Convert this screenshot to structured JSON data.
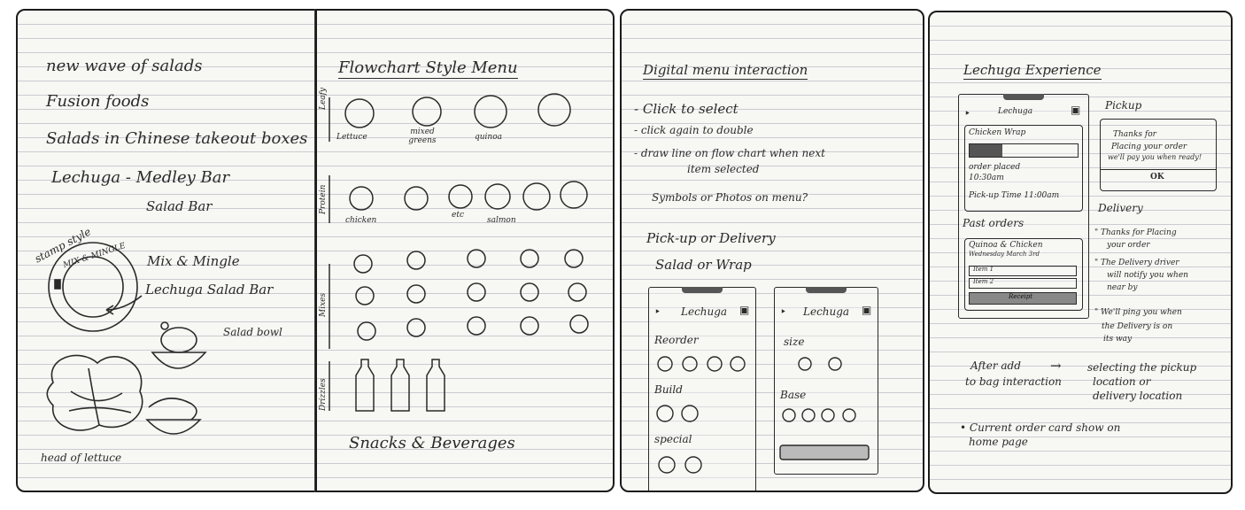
{
  "page1": {
    "lines": [
      "new wave of salads",
      "Fusion foods",
      "Salads in Chinese takeout boxes",
      "Lechuga - Medley Bar",
      "Salad Bar"
    ],
    "stamp_label": "stamp style",
    "stamp_ring_text": "MIX & MINGLE",
    "stamp_names": [
      "Mix & Mingle",
      "Lechuga Salad Bar"
    ],
    "salad_bowl": "Salad bowl",
    "head_of_lettuce": "head of lettuce"
  },
  "page2": {
    "title": "Flowchart Style Menu",
    "rows": [
      "Leafy",
      "Protein",
      "Mixes",
      "Drizzles"
    ],
    "leafy_labels": [
      "Lettuce",
      "mixed greens",
      "quinoa"
    ],
    "protein_labels": [
      "chicken",
      "etc",
      "salmon"
    ],
    "footer": "Snacks & Beverages"
  },
  "page3": {
    "title": "Digital menu interaction",
    "bullets": [
      "- Click to select",
      "- click again to double",
      "- draw line on flow chart when next",
      "item selected"
    ],
    "question": "Symbols or Photos on menu?",
    "options": [
      "Pick-up or Delivery",
      "Salad or Wrap"
    ],
    "phone_brand": "Lechuga",
    "phone1_sections": [
      "Reorder",
      "Build",
      "special"
    ],
    "phone2_sections": [
      "size",
      "Base"
    ]
  },
  "page4": {
    "title": "Lechuga Experience",
    "phone_brand": "Lechuga",
    "order_item": "Chicken Wrap",
    "order_placed": "order placed",
    "order_time": "10:30am",
    "pickup_time": "Pick-up Time 11:00am",
    "past_orders": "Past orders",
    "past_item": "Quinoa & Chicken",
    "past_date": "Wednesday March 3rd",
    "items": [
      "Item 1",
      "Item 2"
    ],
    "receipt": "Receipt",
    "pickup_label": "Pickup",
    "dialog_lines": [
      "Thanks for",
      "Placing your order",
      "we'll pay you when ready!"
    ],
    "dialog_ok": "OK",
    "delivery_label": "Delivery",
    "delivery_quotes": [
      "\" Thanks for Placing",
      "your order",
      "\" The Delivery driver",
      "will notify you when",
      "near by",
      "\" We'll ping you when",
      "the Delivery is on",
      "its way"
    ],
    "after_lines": [
      "After add",
      "to bag interaction"
    ],
    "arrow": "→",
    "selecting_lines": [
      "selecting the pickup",
      "location or",
      "delivery location"
    ],
    "current_lines": [
      "• Current order card show on",
      "home page"
    ]
  }
}
